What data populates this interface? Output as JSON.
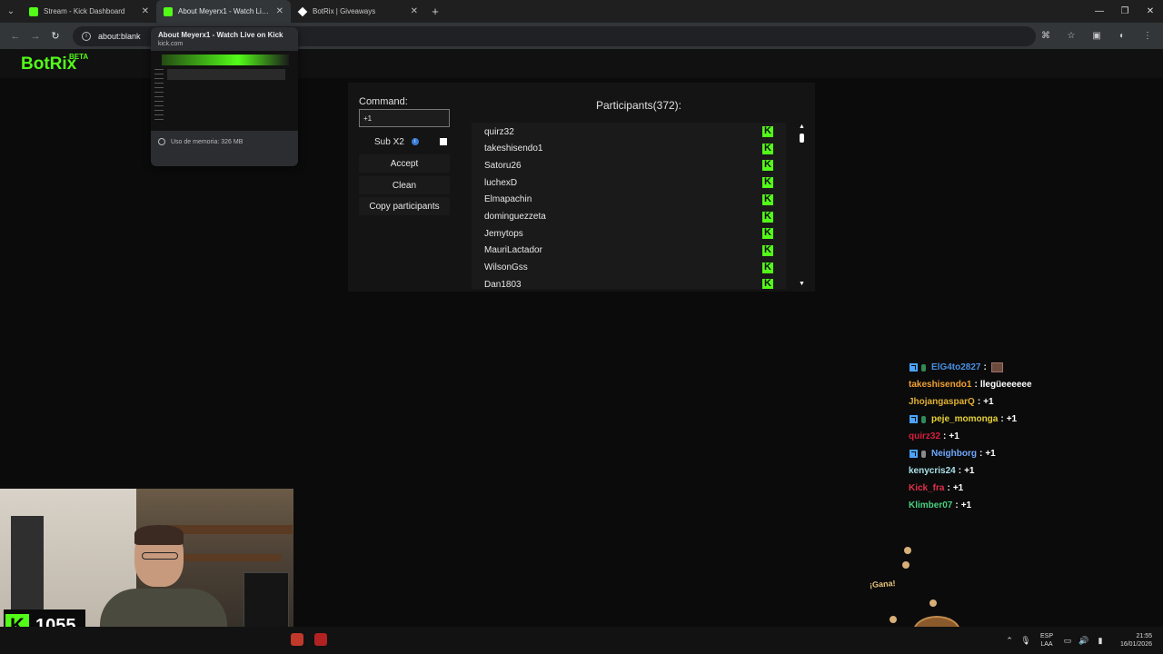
{
  "browser": {
    "tabs": [
      {
        "title": "Stream - Kick Dashboard",
        "favicon": "kick-icon",
        "active": false
      },
      {
        "title": "About Meyerx1 - Watch Live on Kick",
        "favicon": "kick-icon",
        "active": true
      },
      {
        "title": "BotRix | Giveaways",
        "favicon": "botrix-icon",
        "active": false
      }
    ],
    "address": "about:blank",
    "preview": {
      "title": "About Meyerx1 - Watch Live on Kick",
      "domain": "kick.com",
      "memory": "Uso de memoria: 326 MB"
    }
  },
  "app": {
    "logo": "BotRix",
    "logo_badge": "BETA",
    "brand_color": "#53fc18"
  },
  "giveaway": {
    "command_label": "Command:",
    "command_value": "+1",
    "sub_label": "Sub X2",
    "accept_label": "Accept",
    "clean_label": "Clean",
    "copy_label": "Copy participants",
    "participants_title": "Participants(372):",
    "participants": [
      "quirz32",
      "takeshisendo1",
      "Satoru26",
      "luchexD",
      "Elmapachin",
      "dominguezzeta",
      "Jemytops",
      "MauriLactador",
      "WilsonGss",
      "Dan1803"
    ]
  },
  "chat": [
    {
      "user": "ElG4to2827",
      "msg": "",
      "color": "#4a90e2",
      "badges": true,
      "emote": true
    },
    {
      "user": "takeshisendo1",
      "msg": "llegüeeeeee",
      "color": "#f0a030",
      "badges": false,
      "emote": false
    },
    {
      "user": "JhojangasparQ",
      "msg": "+1",
      "color": "#e0b030",
      "badges": false,
      "emote": false
    },
    {
      "user": "peje_momonga",
      "msg": "+1",
      "color": "#e7d13a",
      "badges": true,
      "emote": false
    },
    {
      "user": "quirz32",
      "msg": "+1",
      "color": "#d81e3c",
      "badges": false,
      "emote": false
    },
    {
      "user": "Neighborg",
      "msg": "+1",
      "color": "#6fa8ff",
      "badges": true,
      "emote": false
    },
    {
      "user": "kenycris24",
      "msg": "+1",
      "color": "#a8e0e8",
      "badges": false,
      "emote": false
    },
    {
      "user": "Kick_fra",
      "msg": "+1",
      "color": "#e0304a",
      "badges": false,
      "emote": false
    },
    {
      "user": "Klimber07",
      "msg": "+1",
      "color": "#48d080",
      "badges": false,
      "emote": false
    }
  ],
  "overlay": {
    "viewer_count": "1055",
    "sprite_text": "¡Gana!"
  },
  "taskbar": {
    "lang_line1": "ESP",
    "lang_line2": "LAA",
    "time": "21:55",
    "date": "16/01/2026"
  }
}
